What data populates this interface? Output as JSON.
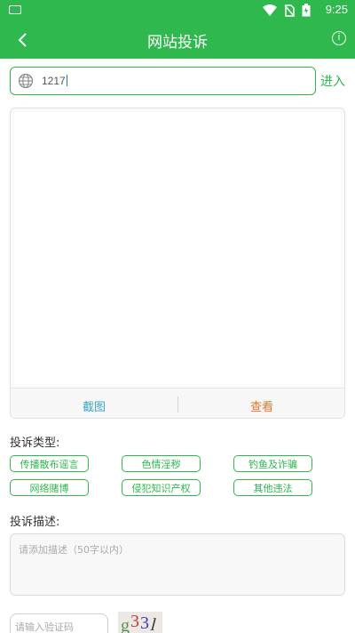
{
  "status_bar": {
    "time": "9:25"
  },
  "app_bar": {
    "title": "网站投诉",
    "info_glyph": "i"
  },
  "url_bar": {
    "value": "1217",
    "enter_label": "进入"
  },
  "preview": {
    "screenshot_label": "截图",
    "view_label": "查看"
  },
  "complaint_type": {
    "label": "投诉类型:",
    "options": [
      "传播散布谣言",
      "色情淫秽",
      "钓鱼及诈骗",
      "网络赌博",
      "侵犯知识产权",
      "其他违法"
    ]
  },
  "description": {
    "label": "投诉描述:",
    "placeholder": "请添加描述（50字以内）"
  },
  "captcha": {
    "placeholder": "请输入验证码",
    "chars": [
      "g",
      "3",
      "3",
      "l"
    ]
  },
  "colors": {
    "brand_green": "#2eb84e",
    "accent_orange": "#e8742a",
    "accent_teal": "#3aa7c8"
  }
}
